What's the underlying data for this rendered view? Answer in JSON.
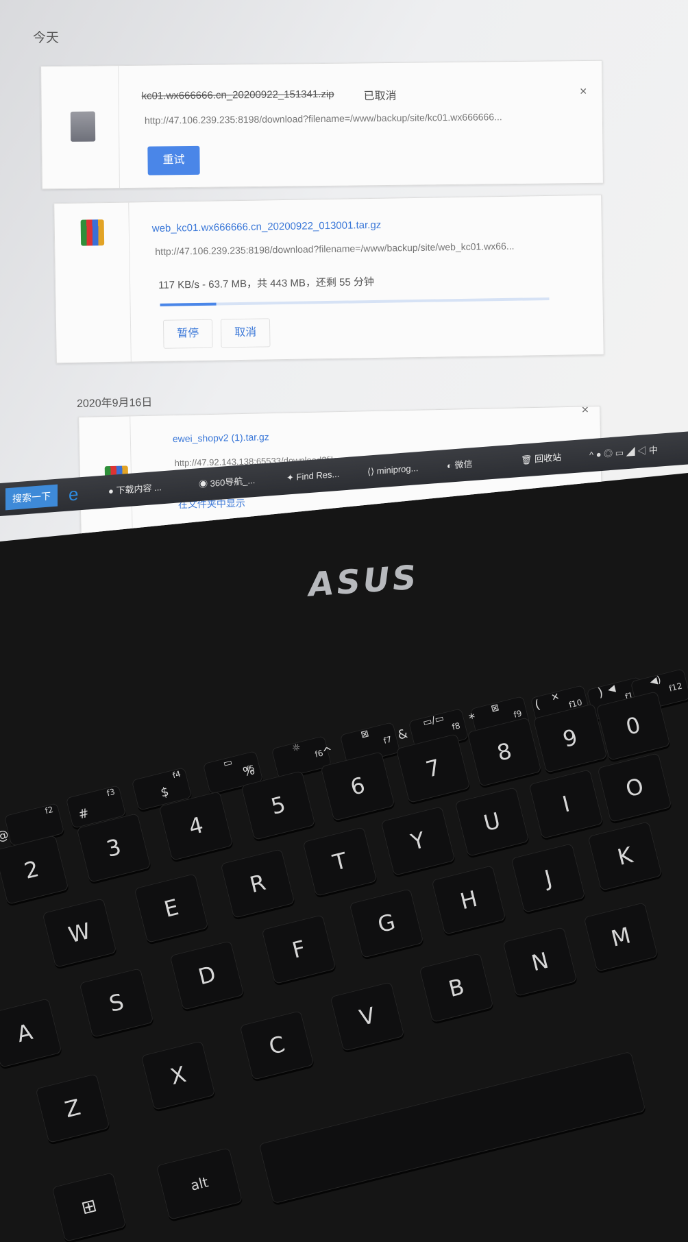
{
  "downloads": {
    "today_label": "今天",
    "items": [
      {
        "filename": "kc01.wx666666.cn_20200922_151341.zip",
        "status": "已取消",
        "url": "http://47.106.239.235:8198/download?filename=/www/backup/site/kc01.wx666666...",
        "retry_label": "重试",
        "close": "×"
      },
      {
        "filename": "web_kc01.wx666666.cn_20200922_013001.tar.gz",
        "url": "http://47.106.239.235:8198/download?filename=/www/backup/site/web_kc01.wx66...",
        "progress_text": "117 KB/s - 63.7 MB，共 443 MB，还剩 55 分钟",
        "progress_fraction": 0.144,
        "pause_label": "暂停",
        "cancel_label": "取消"
      }
    ],
    "date_label": "2020年9月16日",
    "older_items": [
      {
        "filename": "ewei_shopv2 (1).tar.gz",
        "url": "http://47.92.143.138:65533/download?filename=%2Fwww%2Fwwwroot%2Ftest.hao...",
        "show_in_folder_label": "在文件夹中显示",
        "close": "×"
      }
    ]
  },
  "taskbar": {
    "search_label": "搜索一下",
    "tasks": [
      {
        "label": "下载内容 ...",
        "icon": "chrome-icon"
      },
      {
        "label": "360导航_...",
        "icon": "360-icon"
      },
      {
        "label": "Find Res...",
        "icon": "find-icon"
      },
      {
        "label": "miniprog...",
        "icon": "code-icon"
      },
      {
        "label": "微信",
        "icon": "wechat-icon"
      },
      {
        "label": "回收站",
        "icon": "recycle-bin-icon"
      }
    ],
    "tray_text": "中"
  },
  "laptop": {
    "brand": "ASUS"
  },
  "keyboard": {
    "fkeys": [
      "f2",
      "f3",
      "f4",
      "f5",
      "f6",
      "f7",
      "f8",
      "f9",
      "f10",
      "f11",
      "f12"
    ],
    "number_row": [
      {
        "main": "2",
        "shift": "@"
      },
      {
        "main": "3",
        "shift": "#"
      },
      {
        "main": "4",
        "shift": "$"
      },
      {
        "main": "5",
        "shift": "%"
      },
      {
        "main": "6",
        "shift": "^"
      },
      {
        "main": "7",
        "shift": "&"
      },
      {
        "main": "8",
        "shift": "*"
      },
      {
        "main": "9",
        "shift": "("
      },
      {
        "main": "0",
        "shift": ")"
      }
    ],
    "row_qwerty": [
      "W",
      "E",
      "R",
      "T",
      "Y",
      "U",
      "I",
      "O"
    ],
    "row_asdf": [
      "A",
      "S",
      "D",
      "F",
      "G",
      "H",
      "J",
      "K"
    ],
    "row_zxcv": [
      "Z",
      "X",
      "C",
      "V",
      "B",
      "N",
      "M"
    ],
    "alt_label": "alt"
  }
}
